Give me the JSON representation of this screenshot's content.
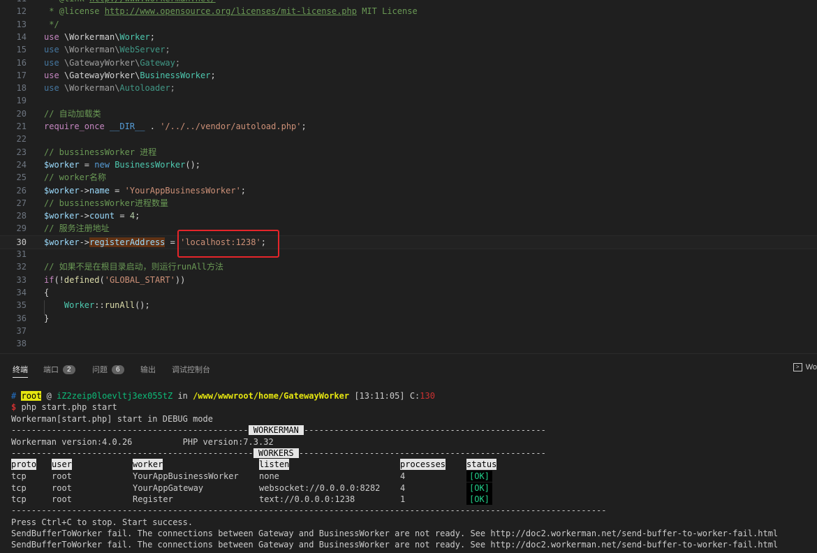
{
  "editor": {
    "lines": [
      {
        "n": "11",
        "t": "link1"
      },
      {
        "n": "12",
        "t": "link2"
      },
      {
        "n": "13",
        "t": "c_end"
      },
      {
        "n": "14",
        "t": "use",
        "ns1": "Workerman",
        "cls": "Worker",
        "muted": false
      },
      {
        "n": "15",
        "t": "use",
        "ns1": "Workerman",
        "cls": "WebServer",
        "muted": true
      },
      {
        "n": "16",
        "t": "use",
        "ns1": "GatewayWorker",
        "cls": "Gateway",
        "muted": true
      },
      {
        "n": "17",
        "t": "use",
        "ns1": "GatewayWorker",
        "cls": "BusinessWorker",
        "muted": false
      },
      {
        "n": "18",
        "t": "use",
        "ns1": "Workerman",
        "cls": "Autoloader",
        "muted": true
      },
      {
        "n": "19",
        "t": "blank"
      },
      {
        "n": "20",
        "t": "comment",
        "text": "// 自动加载类"
      },
      {
        "n": "21",
        "t": "require"
      },
      {
        "n": "22",
        "t": "blank"
      },
      {
        "n": "23",
        "t": "comment",
        "text": "// bussinessWorker 进程"
      },
      {
        "n": "24",
        "t": "new"
      },
      {
        "n": "25",
        "t": "comment",
        "text": "// worker名称"
      },
      {
        "n": "26",
        "t": "assign",
        "prop": "name",
        "val": "'YourAppBusinessWorker'",
        "num": false
      },
      {
        "n": "27",
        "t": "comment",
        "text": "// bussinessWorker进程数量"
      },
      {
        "n": "28",
        "t": "assign",
        "prop": "count",
        "val": "4",
        "num": true
      },
      {
        "n": "29",
        "t": "comment",
        "text": "// 服务注册地址"
      },
      {
        "n": "30",
        "t": "register"
      },
      {
        "n": "31",
        "t": "blank"
      },
      {
        "n": "32",
        "t": "comment",
        "text": "// 如果不是在根目录启动，则运行runAll方法"
      },
      {
        "n": "33",
        "t": "if"
      },
      {
        "n": "34",
        "t": "brace",
        "text": "{"
      },
      {
        "n": "35",
        "t": "runall"
      },
      {
        "n": "36",
        "t": "brace",
        "text": "}"
      },
      {
        "n": "37",
        "t": "blank"
      },
      {
        "n": "38",
        "t": "blank"
      }
    ],
    "tokens": {
      "link_tag": "@link",
      "link_url": "http://www.workerman.net/",
      "license_tag": "@license",
      "license_url": "http://www.opensource.org/licenses/mit-license.php",
      "license_txt": " MIT License",
      "star": "*",
      "comment_end": "*/",
      "use_kw": "use",
      "backslash": "\\",
      "semi": ";",
      "require_kw": "require_once",
      "dir_const": "__DIR__",
      "dot": " . ",
      "autoload_path": "'/../../vendor/autoload.php'",
      "worker_var": "$worker",
      "arrow": "->",
      "eq": " = ",
      "new_kw": "new",
      "bw_cls": "BusinessWorker",
      "call_parens": "();",
      "register_prop": "registerAddress",
      "register_val": "'localhost:1238'",
      "if_kw": "if",
      "if_open": "(!",
      "defined_fn": "defined",
      "paren_open": "(",
      "global_start": "'GLOBAL_START'",
      "if_close": "))",
      "worker_cls": "Worker",
      "static_op": "::",
      "runall_fn": "runAll"
    }
  },
  "panel": {
    "tabs": [
      {
        "label": "终端",
        "badge": ""
      },
      {
        "label": "端口",
        "badge": "2"
      },
      {
        "label": "问题",
        "badge": "6"
      },
      {
        "label": "输出",
        "badge": ""
      },
      {
        "label": "调试控制台",
        "badge": ""
      }
    ],
    "right_label": "Wo",
    "right_icon": ">"
  },
  "terminal": {
    "prompt": {
      "hash": "#",
      "user": "root",
      "at": " @ ",
      "host": "iZ2zeip0loevltj3ex055tZ",
      "in": " in ",
      "path": "/www/wwwroot/home/GatewayWorker",
      "time": " [13:11:05] ",
      "c_label": "C:",
      "c_val": "130"
    },
    "cmd": {
      "dollar": "$",
      "text": " php start.php start"
    },
    "debug_line": "Workerman[start.php] start in DEBUG mode",
    "dash_left": "-----------------------------------------------",
    "workerman_label": " WORKERMAN ",
    "dash_right": "------------------------------------------------",
    "version_line": "Workerman version:4.0.26          PHP version:7.3.32",
    "dash_left2": "------------------------------------------------",
    "workers_label": " WORKERS ",
    "dash_right2": "-------------------------------------------------",
    "headers": [
      "proto",
      "user",
      "worker",
      "listen",
      "processes",
      "status"
    ],
    "rows": [
      {
        "proto": "tcp",
        "user": "root",
        "worker": "YourAppBusinessWorker",
        "listen": "none",
        "processes": "4",
        "status": "[OK]"
      },
      {
        "proto": "tcp",
        "user": "root",
        "worker": "YourAppGateway",
        "listen": "websocket://0.0.0.0:8282",
        "processes": "4",
        "status": "[OK]"
      },
      {
        "proto": "tcp",
        "user": "root",
        "worker": "Register",
        "listen": "text://0.0.0.0:1238",
        "processes": "1",
        "status": "[OK]"
      }
    ],
    "dash_full": "----------------------------------------------------------------------------------------------------------------------",
    "stop_line": "Press Ctrl+C to stop. Start success.",
    "fail_line": "SendBufferToWorker fail. The connections between Gateway and BusinessWorker are not ready. See http://doc2.workerman.net/send-buffer-to-worker-fail.html",
    "cursor": "▯"
  }
}
